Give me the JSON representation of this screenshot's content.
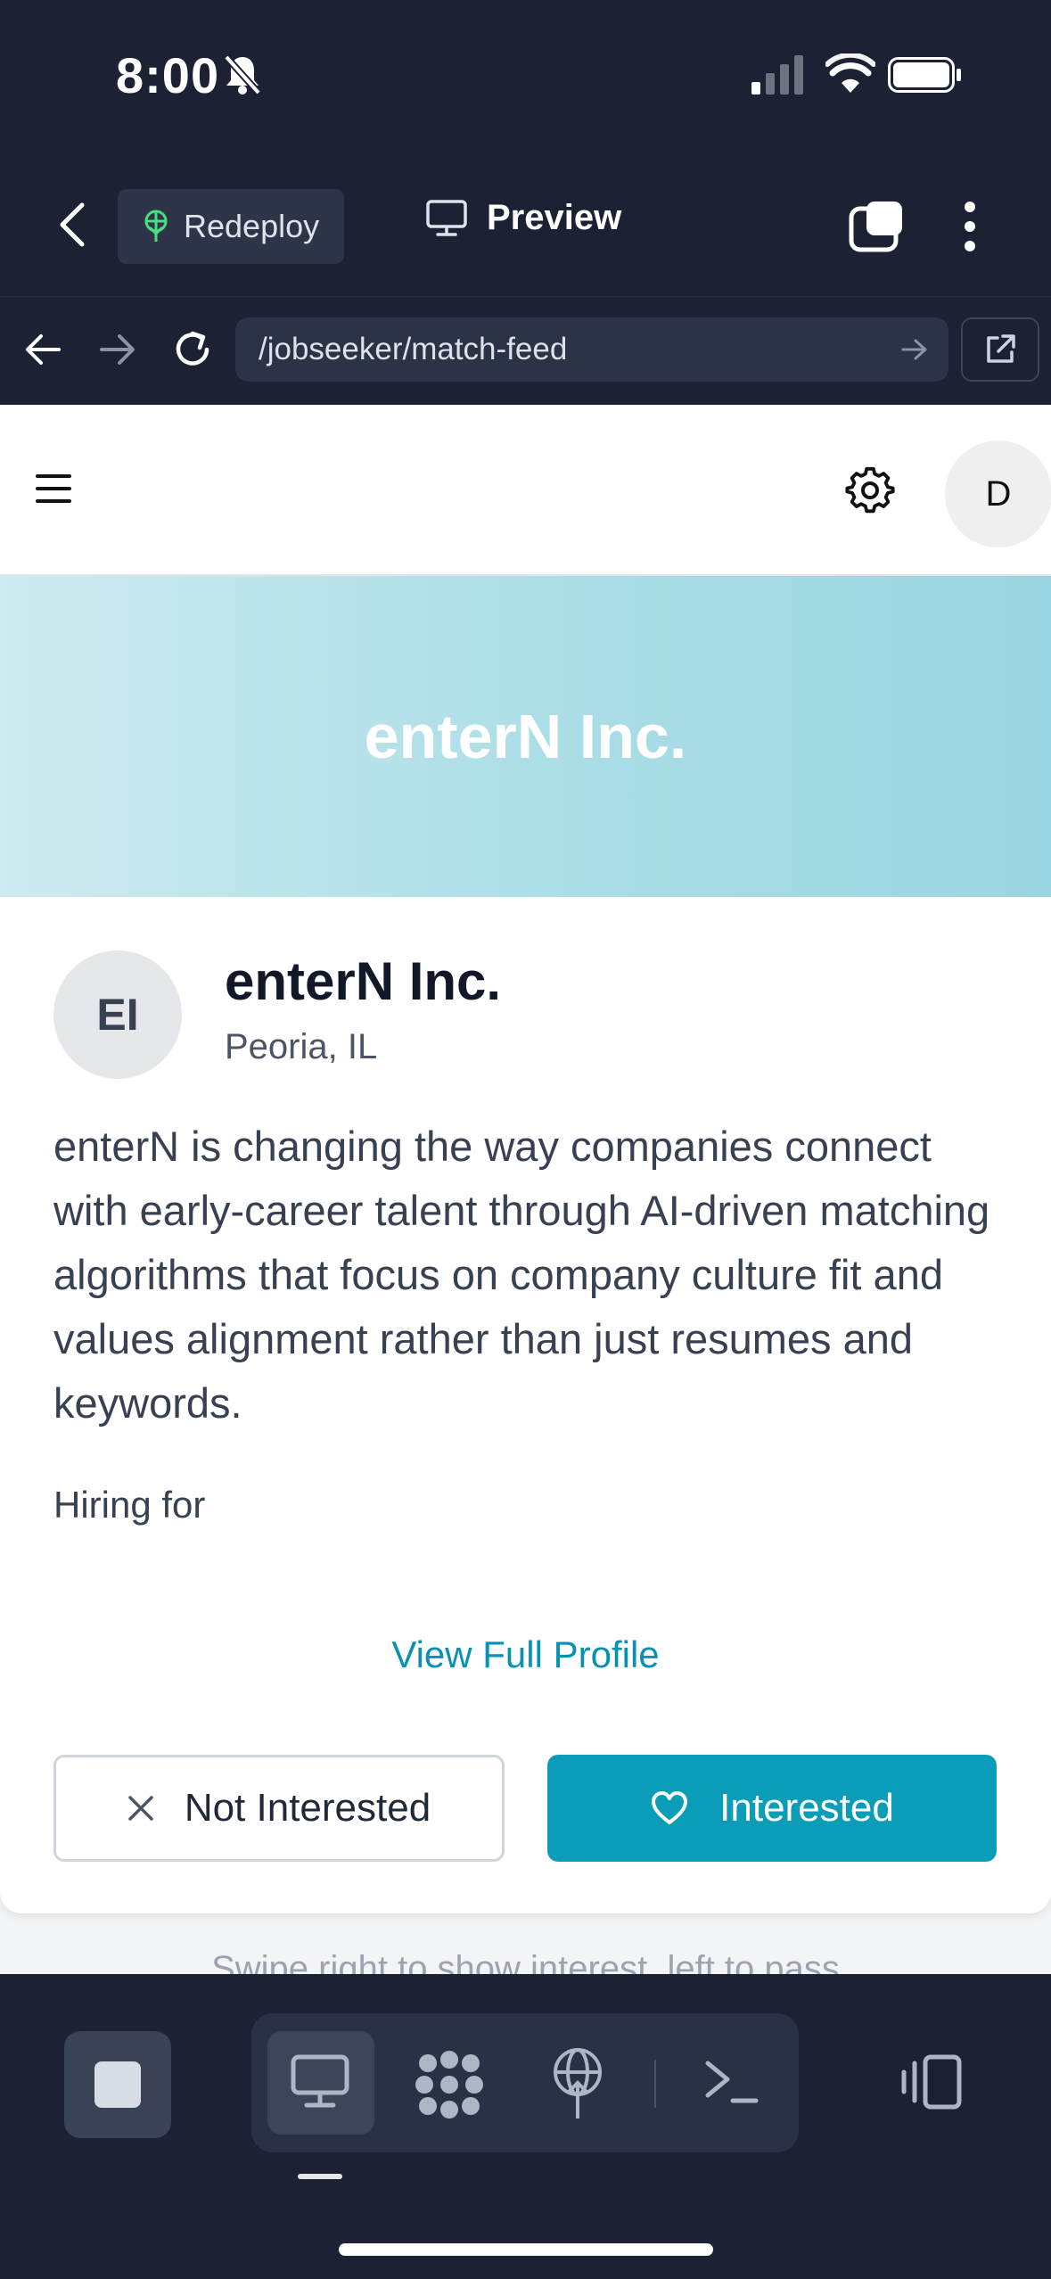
{
  "status_bar": {
    "time": "8:00"
  },
  "top_bar": {
    "redeploy_label": "Redeploy",
    "preview_label": "Preview"
  },
  "url_bar": {
    "url": "/jobseeker/match-feed"
  },
  "app_header": {
    "avatar_initial": "D"
  },
  "card": {
    "banner_title": "enterN Inc.",
    "logo_initials": "EI",
    "company_name": "enterN Inc.",
    "location": "Peoria, IL",
    "description": "enterN is changing the way companies connect with early-career talent through AI-driven matching algorithms that focus on company culture fit and values alignment rather than just resumes and keywords.",
    "hiring_for_label": "Hiring for",
    "view_profile_label": "View Full Profile",
    "not_interested_label": "Not Interested",
    "interested_label": "Interested"
  },
  "swipe_hint": "Swipe right to show interest, left to pass",
  "colors": {
    "accent": "#0b9db8",
    "link": "#0891b2",
    "chrome_bg": "#1c2233"
  },
  "icons": [
    "bell-slash-icon",
    "signal-icon",
    "wifi-icon",
    "battery-icon",
    "chevron-left-icon",
    "redeploy-icon",
    "monitor-icon",
    "tabs-icon",
    "more-vertical-icon",
    "arrow-left-icon",
    "arrow-right-icon",
    "reload-icon",
    "external-link-icon",
    "menu-icon",
    "gear-icon",
    "close-icon",
    "heart-icon",
    "stop-icon",
    "desktop-icon",
    "agent-dots-icon",
    "globe-icon",
    "terminal-icon",
    "panel-icon"
  ]
}
